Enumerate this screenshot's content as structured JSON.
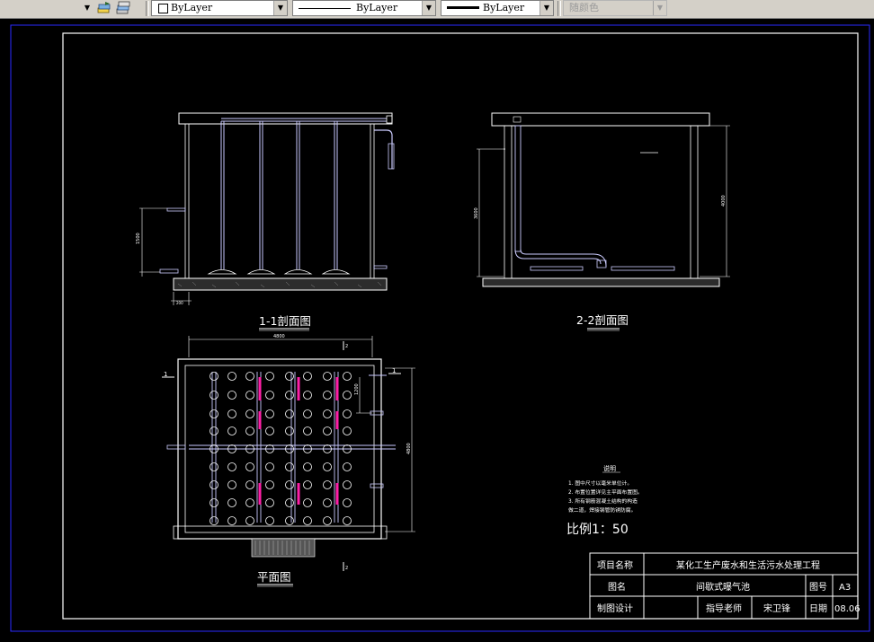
{
  "toolbar": {
    "color_value": "ByLayer",
    "linetype_value": "ByLayer",
    "lineweight_value": "ByLayer",
    "plotstyle_value": "随颜色"
  },
  "drawing": {
    "section_1_title": "1-1剖面图",
    "section_2_title": "2-2剖面图",
    "plan_title": "平面图",
    "scale_label": "比例1：50",
    "dim_4800_top": "4800",
    "dim_4800_side": "4800",
    "dim_4000": "4000",
    "dim_3600": "3600",
    "dim_1500": "1500",
    "dim_1200": "1200",
    "dim_200": "200",
    "mark_1": "1",
    "mark_2": "2",
    "notes_title": "说明",
    "notes": [
      "1. 图中尺寸以毫米单位计。",
      "2. 布置位置详见主平面布置图。",
      "3. 所有钢筋混凝土结构的构造",
      "   做二道，焊接钢管防锈防腐。"
    ]
  },
  "title_block": {
    "project_label": "项目名称",
    "project_name": "某化工生产废水和生活污水处理工程",
    "drawing_name_label": "图名",
    "drawing_name": "间歇式曝气池",
    "drawing_no_label": "图号",
    "drawing_no": "A3",
    "designer_label": "制图设计",
    "advisor_label": "指导老师",
    "advisor_name": "宋卫锋",
    "date_label": "日期",
    "date_value": "08.06"
  }
}
